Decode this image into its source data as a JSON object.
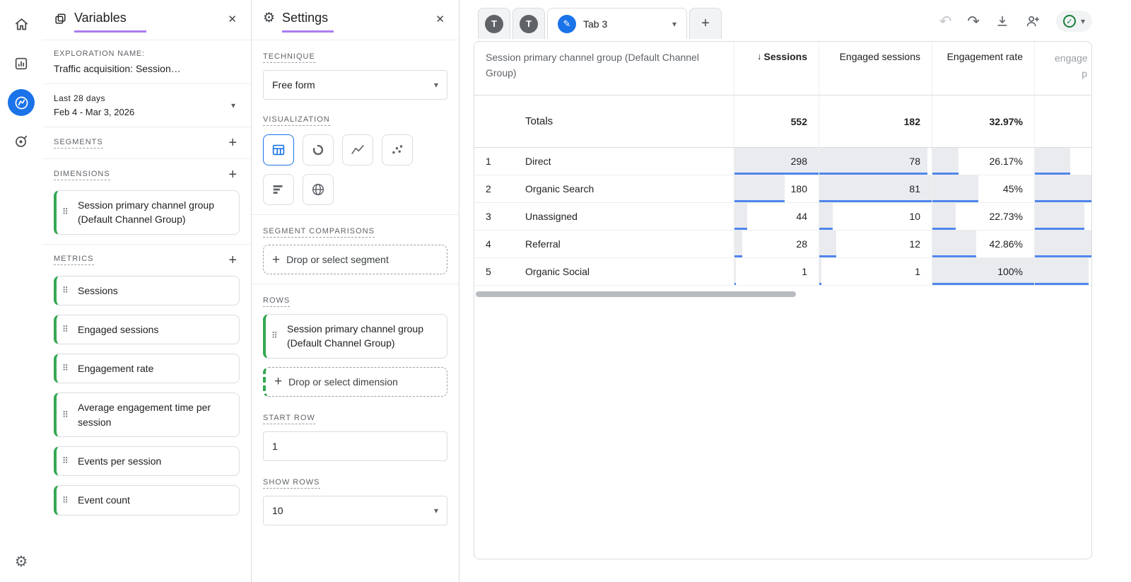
{
  "colors": {
    "purple": "#ab7cf2",
    "blue": "#1a73e8",
    "bar-blue": "#4f86ec",
    "green": "#188038",
    "chip-green": "#34a853",
    "text": "#202124",
    "text-secondary": "#5f6368",
    "border": "#dadce0",
    "bar-fill": "#e9ebee"
  },
  "icons": {
    "close": "✕",
    "caret_down": "▾",
    "plus": "+",
    "drag_handle": "⠿",
    "undo": "↶",
    "redo": "↷",
    "sort_down": "↓",
    "check": "✓",
    "gear": "⚙",
    "pencil": "✎"
  },
  "variables": {
    "title": "Variables",
    "exploration_name_label": "EXPLORATION NAME:",
    "exploration_name": "Traffic acquisition: Session…",
    "date_range_primary": "Last 28 days",
    "date_range_secondary": "Feb 4 - Mar 3, 2026",
    "segments_label": "SEGMENTS",
    "dimensions_label": "DIMENSIONS",
    "dimension_chip": "Session primary channel group (Default Channel Group)",
    "metrics_label": "METRICS",
    "metrics": [
      "Sessions",
      "Engaged sessions",
      "Engagement rate",
      "Average engagement time per session",
      "Events per session",
      "Event count"
    ]
  },
  "settings": {
    "title": "Settings",
    "technique_label": "TECHNIQUE",
    "technique_value": "Free form",
    "visualization_label": "VISUALIZATION",
    "segment_comparisons_label": "SEGMENT COMPARISONS",
    "segment_drop": "Drop or select segment",
    "rows_label": "ROWS",
    "rows_chip": "Session primary channel group (Default Channel Group)",
    "dimension_drop": "Drop or select dimension",
    "start_row_label": "START ROW",
    "start_row_value": "1",
    "show_rows_label": "SHOW ROWS",
    "show_rows_value": "10"
  },
  "canvas": {
    "tab1": "T",
    "tab2": "T",
    "active_tab": "Tab 3",
    "table": {
      "header_dimension": "Session primary channel group (Default Channel Group)",
      "header_sessions": "Sessions",
      "header_engaged": "Engaged sessions",
      "header_rate": "Engagement rate",
      "header_partial_1": "engage",
      "header_partial_2": "p",
      "totals_label": "Totals",
      "totals": {
        "sessions": "552",
        "engaged": "182",
        "rate": "32.97%"
      },
      "rows": [
        {
          "index": "1",
          "name": "Direct",
          "sessions": "298",
          "engaged": "78",
          "rate": "26.17%",
          "bar_sessions": "100%",
          "bar_engaged": "96%",
          "bar_rate": "26%",
          "bar_extra": "62%"
        },
        {
          "index": "2",
          "name": "Organic Search",
          "sessions": "180",
          "engaged": "81",
          "rate": "45%",
          "bar_sessions": "60%",
          "bar_engaged": "100%",
          "bar_rate": "45%",
          "bar_extra": "100%"
        },
        {
          "index": "3",
          "name": "Unassigned",
          "sessions": "44",
          "engaged": "10",
          "rate": "22.73%",
          "bar_sessions": "15%",
          "bar_engaged": "12%",
          "bar_rate": "23%",
          "bar_extra": "88%"
        },
        {
          "index": "4",
          "name": "Referral",
          "sessions": "28",
          "engaged": "12",
          "rate": "42.86%",
          "bar_sessions": "9%",
          "bar_engaged": "15%",
          "bar_rate": "43%",
          "bar_extra": "100%"
        },
        {
          "index": "5",
          "name": "Organic Social",
          "sessions": "1",
          "engaged": "1",
          "rate": "100%",
          "bar_sessions": "2%",
          "bar_engaged": "2%",
          "bar_rate": "100%",
          "bar_extra": "95%"
        }
      ]
    }
  }
}
